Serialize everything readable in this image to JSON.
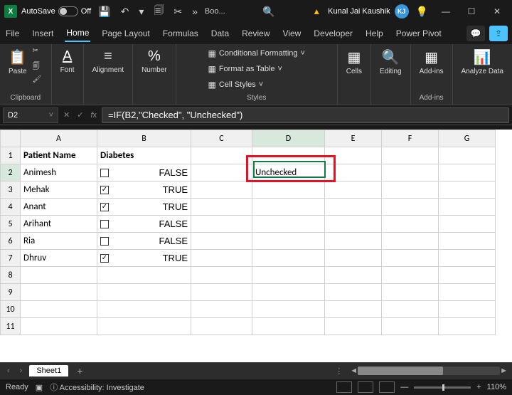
{
  "titlebar": {
    "autosave_label": "AutoSave",
    "autosave_state": "Off",
    "doc_name": "Boo...",
    "user_name": "Kunal Jai Kaushik",
    "user_initials": "KJ"
  },
  "tabs": {
    "file": "File",
    "insert": "Insert",
    "home": "Home",
    "page_layout": "Page Layout",
    "formulas": "Formulas",
    "data": "Data",
    "review": "Review",
    "view": "View",
    "developer": "Developer",
    "help": "Help",
    "power_pivot": "Power Pivot"
  },
  "ribbon": {
    "paste": "Paste",
    "clipboard": "Clipboard",
    "font": "Font",
    "alignment": "Alignment",
    "number": "Number",
    "cond_fmt": "Conditional Formatting",
    "fmt_table": "Format as Table",
    "cell_styles": "Cell Styles",
    "styles": "Styles",
    "cells": "Cells",
    "editing": "Editing",
    "addins": "Add-ins",
    "analyze": "Analyze Data"
  },
  "formula_bar": {
    "name_box": "D2",
    "formula": "=IF(B2,\"Checked\", \"Unchecked\")"
  },
  "columns": [
    "A",
    "B",
    "C",
    "D",
    "E",
    "F",
    "G"
  ],
  "headers": {
    "a": "Patient Name",
    "b": "Diabetes"
  },
  "rows": [
    {
      "name": "Animesh",
      "checked": false,
      "val": "FALSE"
    },
    {
      "name": "Mehak",
      "checked": true,
      "val": "TRUE"
    },
    {
      "name": "Anant",
      "checked": true,
      "val": "TRUE"
    },
    {
      "name": "Arihant",
      "checked": false,
      "val": "FALSE"
    },
    {
      "name": "Ria",
      "checked": false,
      "val": "FALSE"
    },
    {
      "name": "Dhruv",
      "checked": true,
      "val": "TRUE"
    }
  ],
  "d2_value": "Unchecked",
  "sheet": {
    "name": "Sheet1"
  },
  "status": {
    "ready": "Ready",
    "accessibility": "Accessibility: Investigate",
    "zoom": "110%"
  }
}
